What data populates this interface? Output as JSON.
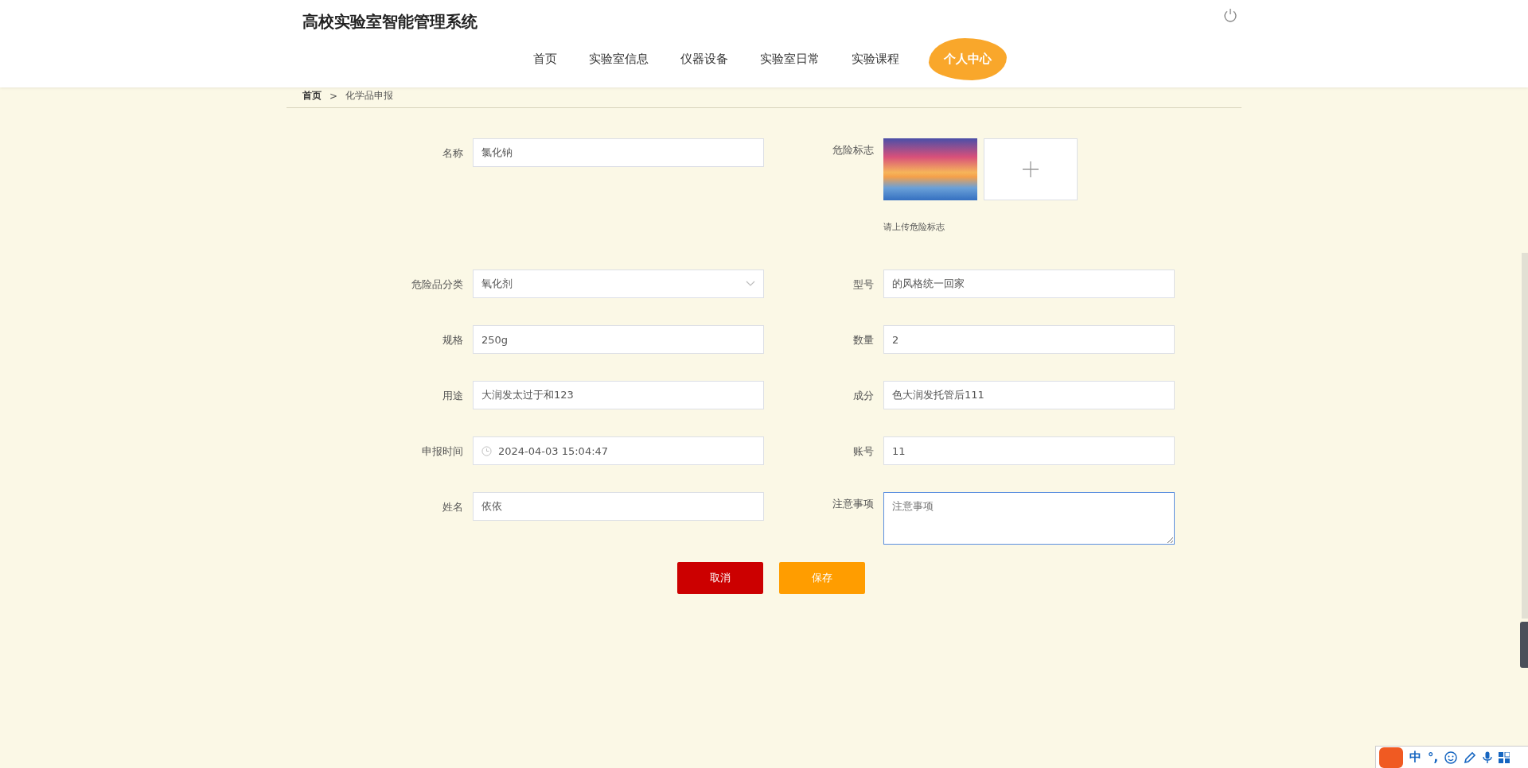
{
  "header": {
    "title": "高校实验室智能管理系统",
    "nav": [
      {
        "label": "首页",
        "selected": false
      },
      {
        "label": "实验室信息",
        "selected": false
      },
      {
        "label": "仪器设备",
        "selected": false
      },
      {
        "label": "实验室日常",
        "selected": false
      },
      {
        "label": "实验课程",
        "selected": false
      },
      {
        "label": "个人中心",
        "selected": true
      }
    ]
  },
  "breadcrumb": {
    "home": "首页",
    "separator": ">",
    "current": "化学品申报"
  },
  "form": {
    "fields": [
      {
        "kind": "text",
        "label": "名称",
        "value": "氯化钠"
      },
      {
        "kind": "upload",
        "label": "危险标志",
        "hint": "请上传危险标志"
      },
      {
        "kind": "select",
        "label": "危险品分类",
        "value": "氧化剂"
      },
      {
        "kind": "text",
        "label": "型号",
        "value": "的风格统一回家"
      },
      {
        "kind": "text",
        "label": "规格",
        "value": "250g"
      },
      {
        "kind": "text",
        "label": "数量",
        "value": "2"
      },
      {
        "kind": "text",
        "label": "用途",
        "value": "大润发太过于和123"
      },
      {
        "kind": "text",
        "label": "成分",
        "value": "色大润发托管后111"
      },
      {
        "kind": "datetime",
        "label": "申报时间",
        "value": "2024-04-03 15:04:47"
      },
      {
        "kind": "text",
        "label": "账号",
        "value": "11"
      },
      {
        "kind": "text",
        "label": "姓名",
        "value": "依依"
      },
      {
        "kind": "textarea",
        "label": "注意事项",
        "placeholder": "注意事项",
        "focused": true
      }
    ],
    "buttons": [
      {
        "kind": "cancel",
        "label": "取消"
      },
      {
        "kind": "save",
        "label": "保存"
      }
    ]
  },
  "ime_toolbar": {
    "mode": "中",
    "punctuation": "°,"
  }
}
